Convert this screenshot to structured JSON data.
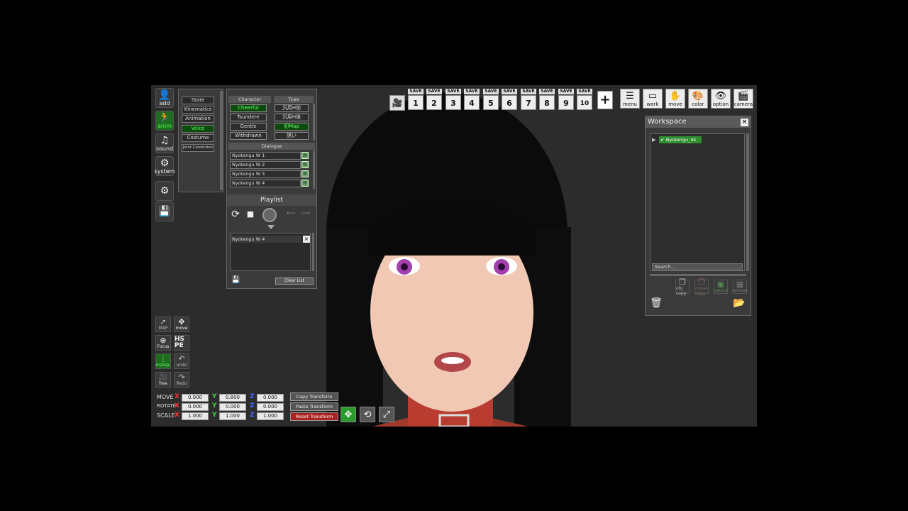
{
  "left_toolbar": {
    "add": "add",
    "anim": "anim",
    "sound": "sound",
    "system": "system"
  },
  "categories": {
    "tabs": [
      "State",
      "Kinematics",
      "Animation",
      "Voice",
      "Costume",
      "Joint Correction"
    ],
    "active": "Voice"
  },
  "voice_panel": {
    "character_header": "Character",
    "type_header": "Type",
    "characters": [
      "Cheerful",
      "Tsundere",
      "Gentle",
      "Withdrawn"
    ],
    "types": [
      "汎用H前",
      "汎用H後",
      "初Map",
      "誘い"
    ],
    "dialogue_header": "Dialogue",
    "dialogue": [
      "Nyotengu W 1",
      "Nyotengu W 2",
      "Nyotengu W 3",
      "Nyotengu W 4"
    ],
    "playlist_title": "Playlist",
    "playlist_items": [
      "Nyotengu W 4"
    ],
    "clear_list": "Clear List"
  },
  "top_bar": {
    "save_label": "SAVE",
    "slots": [
      "1",
      "2",
      "3",
      "4",
      "5",
      "6",
      "7",
      "8",
      "9",
      "10"
    ],
    "plus": "+",
    "buttons": [
      "menu",
      "work",
      "move",
      "color",
      "option",
      "camera"
    ]
  },
  "workspace": {
    "title": "Workspace",
    "close": "×",
    "items": [
      "Nyotengu_4k"
    ],
    "search_placeholder": "Search...",
    "actions": [
      "obj copy",
      "move copy",
      "parent",
      "release"
    ]
  },
  "left_bottom": {
    "buttons": [
      "MAP",
      "move",
      "Focus",
      "HS PE",
      "manip.",
      "undo",
      "free",
      "Redo"
    ]
  },
  "transform": {
    "rows": [
      {
        "label": "MOVE",
        "x": "0.000",
        "y": "0.800",
        "z": "0.000"
      },
      {
        "label": "ROTATE",
        "x": "0.000",
        "y": "0.000",
        "z": "0.000"
      },
      {
        "label": "SCALE",
        "x": "1.000",
        "y": "1.000",
        "z": "1.000"
      }
    ],
    "axis_x": "X",
    "axis_y": "Y",
    "axis_z": "Z",
    "copy": "Copy Transform",
    "paste": "Paste Transform",
    "reset": "Reset Transform"
  }
}
